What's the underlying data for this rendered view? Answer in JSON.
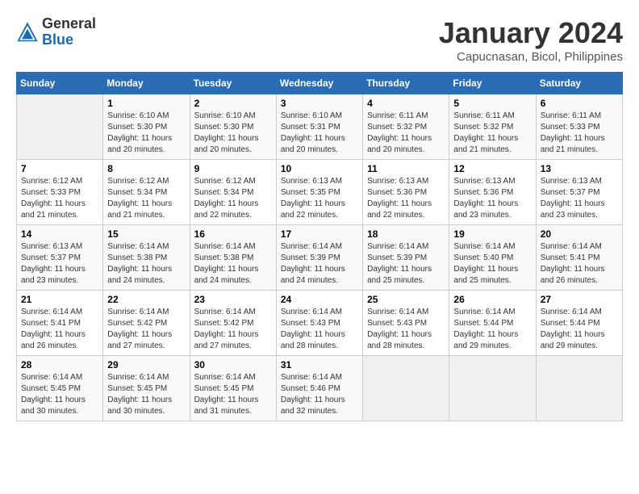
{
  "header": {
    "logo_general": "General",
    "logo_blue": "Blue",
    "title": "January 2024",
    "subtitle": "Capucnasan, Bicol, Philippines"
  },
  "calendar": {
    "days_of_week": [
      "Sunday",
      "Monday",
      "Tuesday",
      "Wednesday",
      "Thursday",
      "Friday",
      "Saturday"
    ],
    "weeks": [
      [
        {
          "day": "",
          "info": ""
        },
        {
          "day": "1",
          "info": "Sunrise: 6:10 AM\nSunset: 5:30 PM\nDaylight: 11 hours and 20 minutes."
        },
        {
          "day": "2",
          "info": "Sunrise: 6:10 AM\nSunset: 5:30 PM\nDaylight: 11 hours and 20 minutes."
        },
        {
          "day": "3",
          "info": "Sunrise: 6:10 AM\nSunset: 5:31 PM\nDaylight: 11 hours and 20 minutes."
        },
        {
          "day": "4",
          "info": "Sunrise: 6:11 AM\nSunset: 5:32 PM\nDaylight: 11 hours and 20 minutes."
        },
        {
          "day": "5",
          "info": "Sunrise: 6:11 AM\nSunset: 5:32 PM\nDaylight: 11 hours and 21 minutes."
        },
        {
          "day": "6",
          "info": "Sunrise: 6:11 AM\nSunset: 5:33 PM\nDaylight: 11 hours and 21 minutes."
        }
      ],
      [
        {
          "day": "7",
          "info": "Sunrise: 6:12 AM\nSunset: 5:33 PM\nDaylight: 11 hours and 21 minutes."
        },
        {
          "day": "8",
          "info": "Sunrise: 6:12 AM\nSunset: 5:34 PM\nDaylight: 11 hours and 21 minutes."
        },
        {
          "day": "9",
          "info": "Sunrise: 6:12 AM\nSunset: 5:34 PM\nDaylight: 11 hours and 22 minutes."
        },
        {
          "day": "10",
          "info": "Sunrise: 6:13 AM\nSunset: 5:35 PM\nDaylight: 11 hours and 22 minutes."
        },
        {
          "day": "11",
          "info": "Sunrise: 6:13 AM\nSunset: 5:36 PM\nDaylight: 11 hours and 22 minutes."
        },
        {
          "day": "12",
          "info": "Sunrise: 6:13 AM\nSunset: 5:36 PM\nDaylight: 11 hours and 23 minutes."
        },
        {
          "day": "13",
          "info": "Sunrise: 6:13 AM\nSunset: 5:37 PM\nDaylight: 11 hours and 23 minutes."
        }
      ],
      [
        {
          "day": "14",
          "info": "Sunrise: 6:13 AM\nSunset: 5:37 PM\nDaylight: 11 hours and 23 minutes."
        },
        {
          "day": "15",
          "info": "Sunrise: 6:14 AM\nSunset: 5:38 PM\nDaylight: 11 hours and 24 minutes."
        },
        {
          "day": "16",
          "info": "Sunrise: 6:14 AM\nSunset: 5:38 PM\nDaylight: 11 hours and 24 minutes."
        },
        {
          "day": "17",
          "info": "Sunrise: 6:14 AM\nSunset: 5:39 PM\nDaylight: 11 hours and 24 minutes."
        },
        {
          "day": "18",
          "info": "Sunrise: 6:14 AM\nSunset: 5:39 PM\nDaylight: 11 hours and 25 minutes."
        },
        {
          "day": "19",
          "info": "Sunrise: 6:14 AM\nSunset: 5:40 PM\nDaylight: 11 hours and 25 minutes."
        },
        {
          "day": "20",
          "info": "Sunrise: 6:14 AM\nSunset: 5:41 PM\nDaylight: 11 hours and 26 minutes."
        }
      ],
      [
        {
          "day": "21",
          "info": "Sunrise: 6:14 AM\nSunset: 5:41 PM\nDaylight: 11 hours and 26 minutes."
        },
        {
          "day": "22",
          "info": "Sunrise: 6:14 AM\nSunset: 5:42 PM\nDaylight: 11 hours and 27 minutes."
        },
        {
          "day": "23",
          "info": "Sunrise: 6:14 AM\nSunset: 5:42 PM\nDaylight: 11 hours and 27 minutes."
        },
        {
          "day": "24",
          "info": "Sunrise: 6:14 AM\nSunset: 5:43 PM\nDaylight: 11 hours and 28 minutes."
        },
        {
          "day": "25",
          "info": "Sunrise: 6:14 AM\nSunset: 5:43 PM\nDaylight: 11 hours and 28 minutes."
        },
        {
          "day": "26",
          "info": "Sunrise: 6:14 AM\nSunset: 5:44 PM\nDaylight: 11 hours and 29 minutes."
        },
        {
          "day": "27",
          "info": "Sunrise: 6:14 AM\nSunset: 5:44 PM\nDaylight: 11 hours and 29 minutes."
        }
      ],
      [
        {
          "day": "28",
          "info": "Sunrise: 6:14 AM\nSunset: 5:45 PM\nDaylight: 11 hours and 30 minutes."
        },
        {
          "day": "29",
          "info": "Sunrise: 6:14 AM\nSunset: 5:45 PM\nDaylight: 11 hours and 30 minutes."
        },
        {
          "day": "30",
          "info": "Sunrise: 6:14 AM\nSunset: 5:45 PM\nDaylight: 11 hours and 31 minutes."
        },
        {
          "day": "31",
          "info": "Sunrise: 6:14 AM\nSunset: 5:46 PM\nDaylight: 11 hours and 32 minutes."
        },
        {
          "day": "",
          "info": ""
        },
        {
          "day": "",
          "info": ""
        },
        {
          "day": "",
          "info": ""
        }
      ]
    ]
  }
}
